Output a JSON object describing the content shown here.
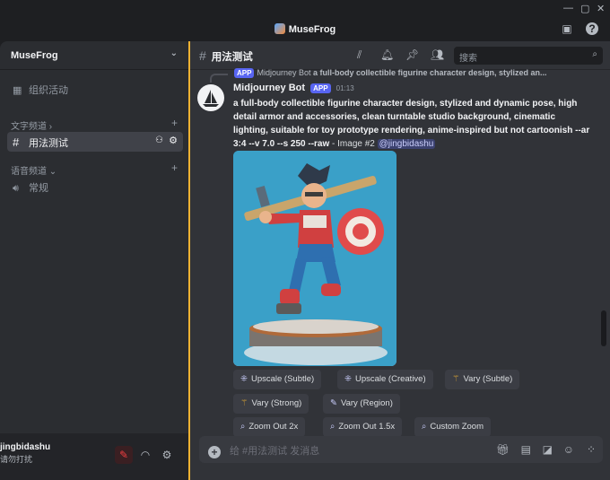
{
  "window": {
    "title": "MuseFrog"
  },
  "sidebar": {
    "guild_name": "MuseFrog",
    "events_label": "组织活动",
    "text_category": "文字频道",
    "text_channel": "用法测试",
    "voice_category": "语音频道",
    "voice_channel": "常规"
  },
  "user": {
    "name": "jingbidashu",
    "status": "请勿打扰"
  },
  "channel": {
    "name": "用法测试",
    "search_placeholder": "搜索"
  },
  "message": {
    "reply_preview": "a full-body collectible figurine character design, stylized an...",
    "reply_author": "Midjourney Bot",
    "author": "Midjourney Bot",
    "app_badge": "APP",
    "time": "01:13",
    "prompt": "a full-body collectible figurine character design, stylized and dynamic pose, high detail armor and accessories, clean turntable studio background, cinematic lighting, suitable for toy prototype rendering, anime-inspired but not cartoonish --ar 3:4 --v 7.0 --s 250 --raw",
    "image_label": " - Image #2 ",
    "mention": "@jingbidashu"
  },
  "buttons": {
    "upscale_subtle": "Upscale (Subtle)",
    "upscale_creative": "Upscale (Creative)",
    "vary_subtle": "Vary (Subtle)",
    "vary_strong": "Vary (Strong)",
    "vary_region": "Vary (Region)",
    "zoom_out_2x": "Zoom Out 2x",
    "zoom_out_15x": "Zoom Out 1.5x",
    "custom_zoom": "Custom Zoom"
  },
  "composer": {
    "placeholder": "给 #用法测试 发消息"
  },
  "colors": {
    "accent": "#5865f2",
    "divider": "#f0b232",
    "muted": "#f23f42"
  }
}
